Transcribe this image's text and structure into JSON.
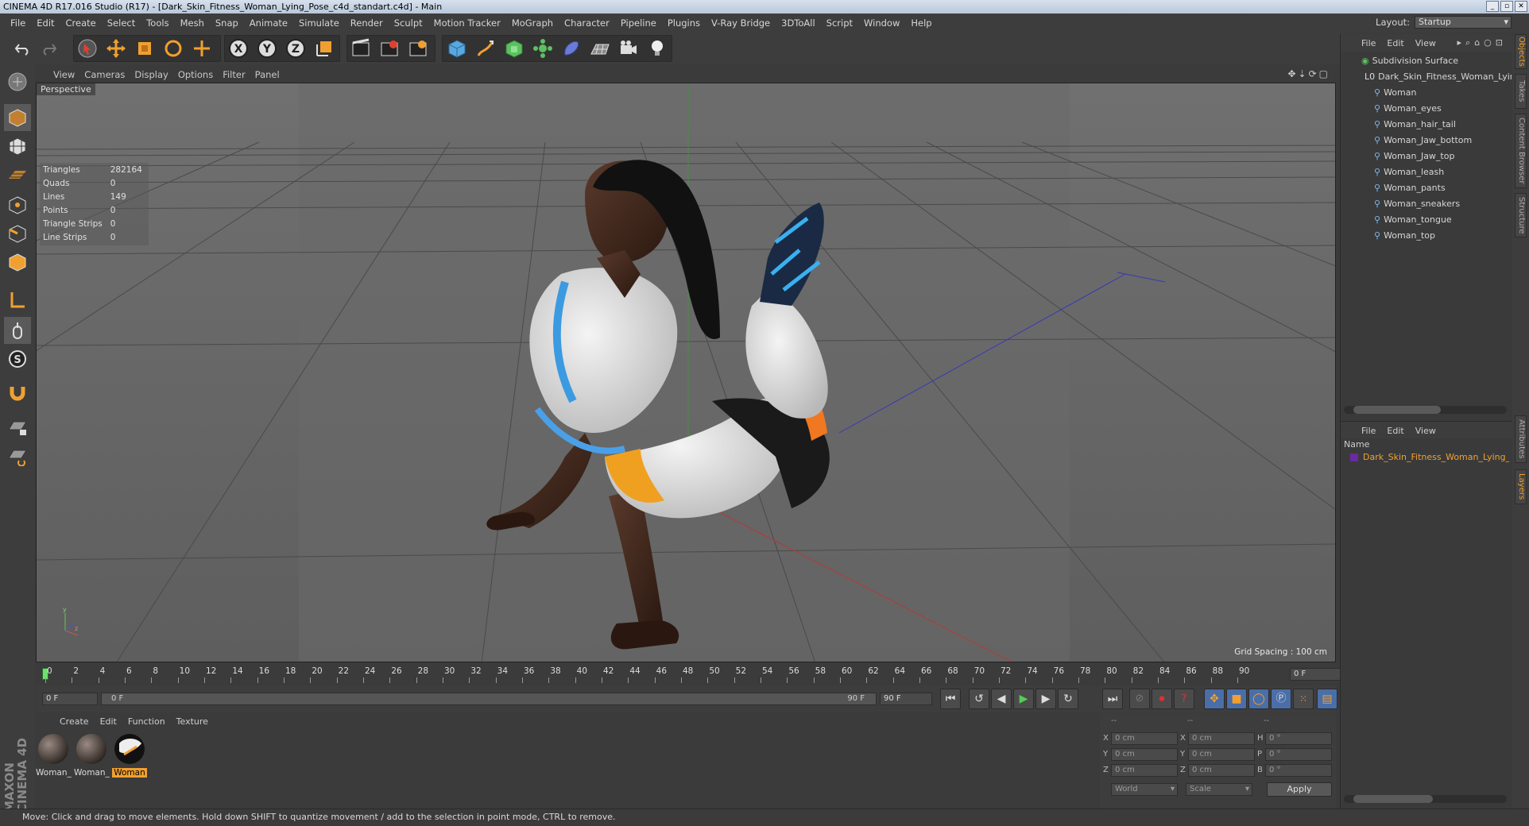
{
  "window": {
    "title": "CINEMA 4D R17.016 Studio (R17) - [Dark_Skin_Fitness_Woman_Lying_Pose_c4d_standart.c4d] - Main"
  },
  "menubar": [
    "File",
    "Edit",
    "Create",
    "Select",
    "Tools",
    "Mesh",
    "Snap",
    "Animate",
    "Simulate",
    "Render",
    "Sculpt",
    "Motion Tracker",
    "MoGraph",
    "Character",
    "Pipeline",
    "Plugins",
    "V-Ray Bridge",
    "3DToAll",
    "Script",
    "Window",
    "Help"
  ],
  "layout": {
    "label": "Layout:",
    "value": "Startup"
  },
  "viewport": {
    "menu": [
      "View",
      "Cameras",
      "Display",
      "Options",
      "Filter",
      "Panel"
    ],
    "label": "Perspective",
    "stats": [
      {
        "name": "Triangles",
        "value": "282164"
      },
      {
        "name": "Quads",
        "value": "0"
      },
      {
        "name": "Lines",
        "value": "149"
      },
      {
        "name": "Points",
        "value": "0"
      },
      {
        "name": "Triangle Strips",
        "value": "0"
      },
      {
        "name": "Line Strips",
        "value": "0"
      }
    ],
    "grid_spacing": "Grid Spacing : 100 cm"
  },
  "timeline": {
    "ticks": [
      "0",
      "2",
      "4",
      "6",
      "8",
      "10",
      "12",
      "14",
      "16",
      "18",
      "20",
      "22",
      "24",
      "26",
      "28",
      "30",
      "32",
      "34",
      "36",
      "38",
      "40",
      "42",
      "44",
      "46",
      "48",
      "50",
      "52",
      "54",
      "56",
      "58",
      "60",
      "62",
      "64",
      "66",
      "68",
      "70",
      "72",
      "74",
      "76",
      "78",
      "80",
      "82",
      "84",
      "86",
      "88",
      "90"
    ],
    "current_frame": "0 F",
    "start": "0 F",
    "slider_start": "0 F",
    "slider_end": "90 F",
    "end": "90 F"
  },
  "material_panel": {
    "menu": [
      "Create",
      "Edit",
      "Function",
      "Texture"
    ],
    "materials": [
      {
        "label": "Woman_",
        "selected": false
      },
      {
        "label": "Woman_",
        "selected": false
      },
      {
        "label": "Woman",
        "selected": true
      }
    ]
  },
  "coords": {
    "headers": [
      "--",
      "--",
      "--"
    ],
    "rows": [
      {
        "a": "X",
        "av": "0 cm",
        "b": "X",
        "bv": "0 cm",
        "c": "H",
        "cv": "0 °"
      },
      {
        "a": "Y",
        "av": "0 cm",
        "b": "Y",
        "bv": "0 cm",
        "c": "P",
        "cv": "0 °"
      },
      {
        "a": "Z",
        "av": "0 cm",
        "b": "Z",
        "bv": "0 cm",
        "c": "B",
        "cv": "0 °"
      }
    ],
    "mode1": "World",
    "mode2": "Scale",
    "apply": "Apply"
  },
  "object_manager": {
    "menu": [
      "File",
      "Edit",
      "View"
    ],
    "root": "Subdivision Surface",
    "group": "Dark_Skin_Fitness_Woman_Lying_P",
    "children": [
      "Woman",
      "Woman_eyes",
      "Woman_hair_tail",
      "Woman_Jaw_bottom",
      "Woman_Jaw_top",
      "Woman_leash",
      "Woman_pants",
      "Woman_sneakers",
      "Woman_tongue",
      "Woman_top"
    ]
  },
  "layer_manager": {
    "menu": [
      "File",
      "Edit",
      "View"
    ],
    "col_name": "Name",
    "item": "Dark_Skin_Fitness_Woman_Lying_Po"
  },
  "side_tabs": [
    "Objects",
    "Takes",
    "Content Browser",
    "Structure",
    "Attributes",
    "Layers"
  ],
  "brand": "MAXON CINEMA 4D",
  "status": "Move: Click and drag to move elements. Hold down SHIFT to quantize movement / add to the selection in point mode, CTRL to remove.",
  "colors": {
    "accent": "#f0a030",
    "selected_obj": "#f0a030",
    "bg": "#3b3b3b"
  }
}
